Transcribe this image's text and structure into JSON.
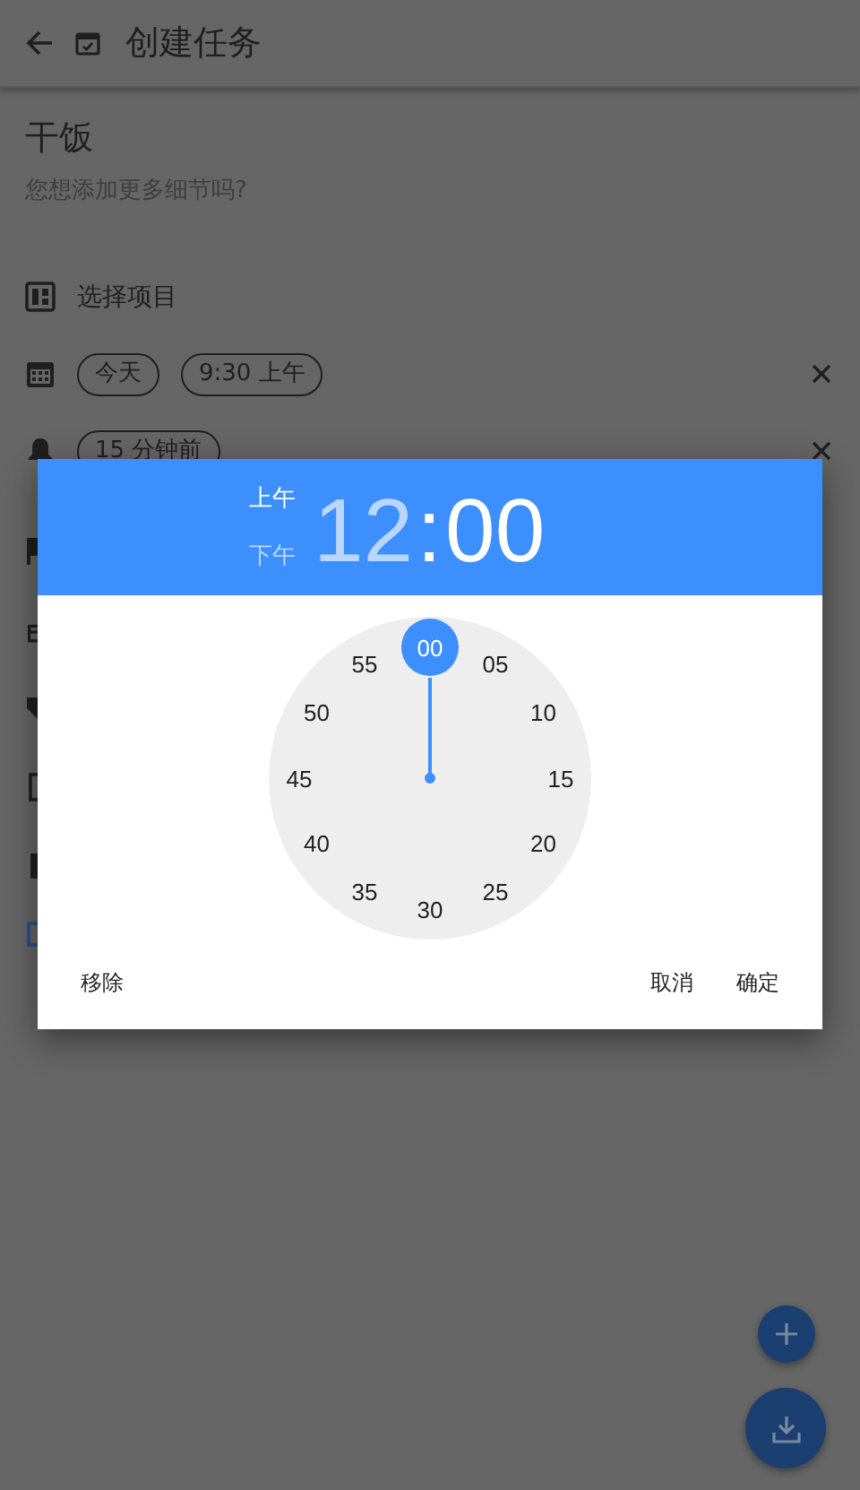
{
  "app_bar": {
    "title": "创建任务"
  },
  "task": {
    "title": "干饭",
    "placeholder": "您想添加更多细节吗?"
  },
  "rows": [
    {
      "kind": "project",
      "label": "选择项目"
    },
    {
      "kind": "date",
      "chips": [
        "今天",
        "9:30 上午"
      ],
      "clearable": true
    },
    {
      "kind": "reminder",
      "chips": [
        "15 分钟前"
      ],
      "clearable": true
    }
  ],
  "time_picker": {
    "periods": [
      {
        "label": "上午",
        "selected": true
      },
      {
        "label": "下午",
        "selected": false
      }
    ],
    "hour": {
      "text": "12",
      "selected": false
    },
    "separator": ":",
    "minute": {
      "text": "00",
      "selected": true
    },
    "dial": [
      {
        "label": "00",
        "selected": true
      },
      {
        "label": "05",
        "selected": false
      },
      {
        "label": "10",
        "selected": false
      },
      {
        "label": "15",
        "selected": false
      },
      {
        "label": "20",
        "selected": false
      },
      {
        "label": "25",
        "selected": false
      },
      {
        "label": "30",
        "selected": false
      },
      {
        "label": "35",
        "selected": false
      },
      {
        "label": "40",
        "selected": false
      },
      {
        "label": "45",
        "selected": false
      },
      {
        "label": "50",
        "selected": false
      },
      {
        "label": "55",
        "selected": false
      }
    ],
    "actions_left": [
      "移除"
    ],
    "actions_right": [
      "取消",
      "确定"
    ]
  }
}
